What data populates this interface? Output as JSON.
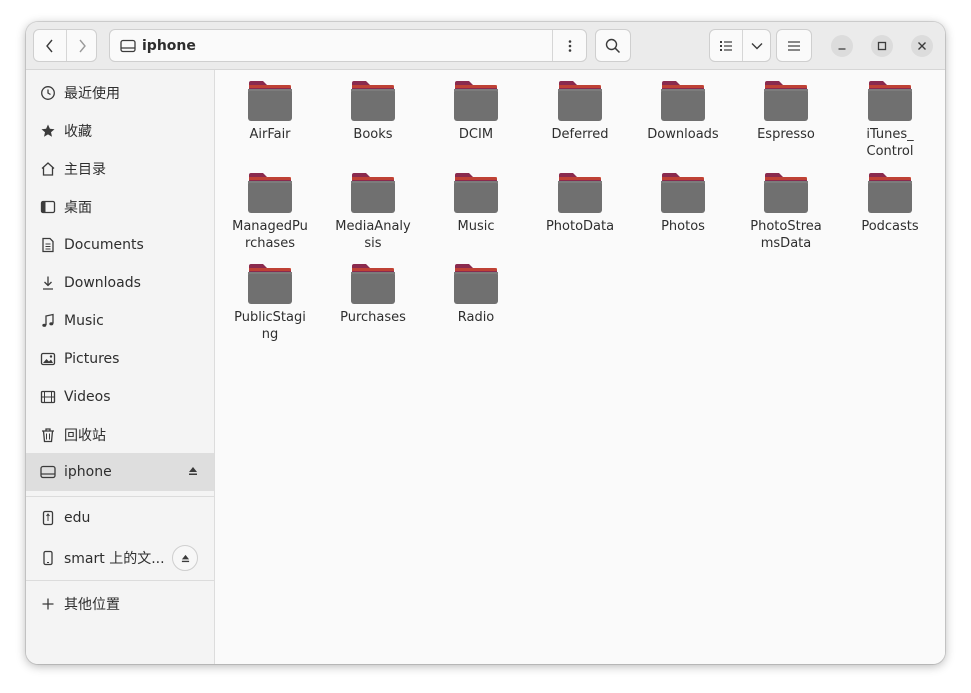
{
  "header": {
    "back_label": "Back",
    "forward_label": "Forward",
    "path_icon": "drive-icon",
    "path_label": "iphone",
    "path_menu_icon": "vertical-dots-icon",
    "search_icon": "search-icon",
    "view_icon": "list-view-icon",
    "view_dropdown_icon": "chevron-down-icon",
    "menu_icon": "hamburger-icon"
  },
  "window_controls": {
    "minimize_icon": "minimize-icon",
    "maximize_icon": "maximize-icon",
    "close_icon": "close-icon"
  },
  "sidebar": {
    "items": [
      {
        "label": "最近使用",
        "icon": "clock-icon"
      },
      {
        "label": "收藏",
        "icon": "star-icon"
      },
      {
        "label": "主目录",
        "icon": "home-icon"
      },
      {
        "label": "桌面",
        "icon": "desktop-icon"
      },
      {
        "label": "Documents",
        "icon": "document-icon"
      },
      {
        "label": "Downloads",
        "icon": "download-icon"
      },
      {
        "label": "Music",
        "icon": "music-icon"
      },
      {
        "label": "Pictures",
        "icon": "picture-icon"
      },
      {
        "label": "Videos",
        "icon": "video-icon"
      },
      {
        "label": "回收站",
        "icon": "trash-icon"
      },
      {
        "label": "iphone",
        "icon": "drive-icon",
        "active": true,
        "eject": true
      }
    ],
    "devices": [
      {
        "label": "edu",
        "icon": "usb-drive-icon"
      },
      {
        "label": "smart 上的文...",
        "icon": "phone-icon",
        "eject": true
      }
    ],
    "other": {
      "label": "其他位置",
      "icon": "plus-icon"
    }
  },
  "files": [
    "AirFair",
    "Books",
    "DCIM",
    "Deferred",
    "Downloads",
    "Espresso",
    "iTunes_\nControl",
    "ManagedPu\nrchases",
    "MediaAnaly\nsis",
    "Music",
    "PhotoData",
    "Photos",
    "PhotoStrea\nmsData",
    "Podcasts",
    "PublicStagi\nng",
    "Purchases",
    "Radio"
  ],
  "colors": {
    "folder_body": "#707070",
    "folder_tab": "#8a2a4e",
    "folder_tab_accent": "#e95420",
    "sidebar_active": "#dedede"
  }
}
